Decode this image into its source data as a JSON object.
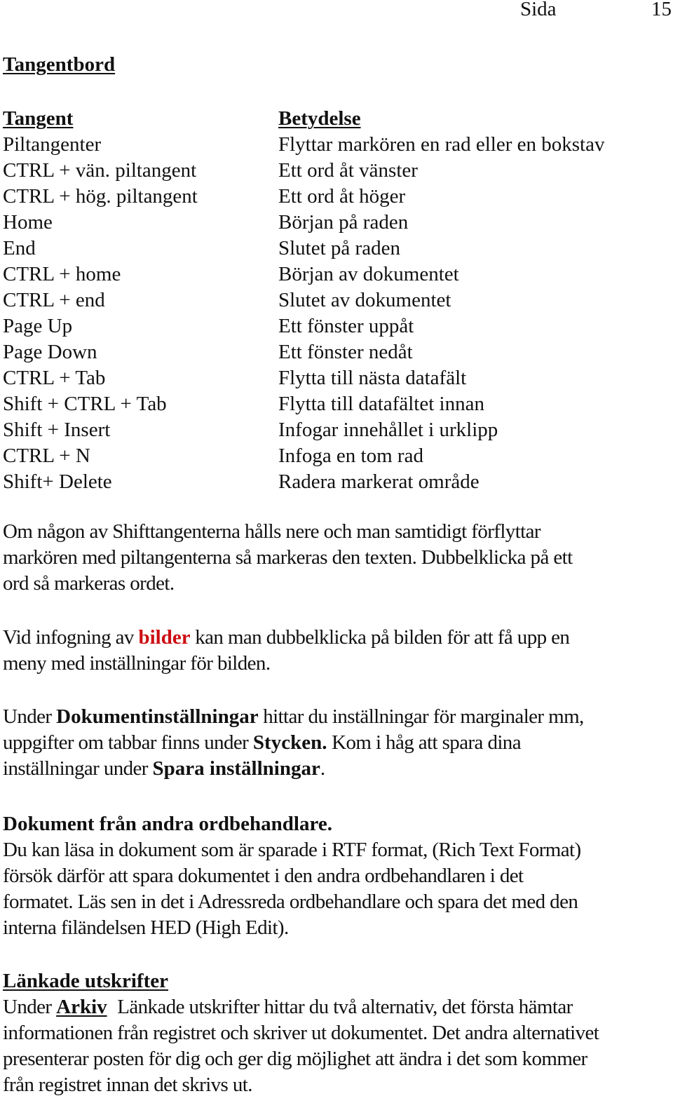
{
  "header": {
    "page_label": "Sida",
    "page_number": "15"
  },
  "title": "Tangentbord",
  "shortcuts": {
    "key_header": "Tangent",
    "desc_header": "Betydelse",
    "rows": [
      {
        "key": "Piltangenter",
        "desc": "Flyttar markören en rad eller en bokstav"
      },
      {
        "key": "CTRL + vän. piltangent",
        "desc": "Ett ord åt vänster"
      },
      {
        "key": "CTRL + hög. piltangent",
        "desc": "Ett ord åt höger"
      },
      {
        "key": "Home",
        "desc": "Början på raden"
      },
      {
        "key": "End",
        "desc": "Slutet på raden"
      },
      {
        "key": "CTRL + home",
        "desc": "Början av dokumentet"
      },
      {
        "key": "CTRL + end",
        "desc": "Slutet av dokumentet"
      },
      {
        "key": "Page Up",
        "desc": "Ett fönster uppåt"
      },
      {
        "key": "Page Down",
        "desc": "Ett fönster nedåt"
      },
      {
        "key": "CTRL + Tab",
        "desc": "Flytta till nästa datafält"
      },
      {
        "key": "Shift + CTRL + Tab",
        "desc": "Flytta till datafältet innan"
      },
      {
        "key": "Shift + Insert",
        "desc": "Infogar innehållet i urklipp"
      },
      {
        "key": "CTRL + N",
        "desc": "Infoga en tom rad"
      },
      {
        "key": "Shift+ Delete",
        "desc": "Radera markerat område"
      }
    ]
  },
  "paragraphs": {
    "shift_select": {
      "lines": [
        "Om någon av Shifttangenterna hålls nere och man samtidigt förflyttar",
        "markören med piltangenterna så markeras den texten. Dubbelklicka på ett",
        "ord så markeras ordet."
      ]
    },
    "images": {
      "pre": "Vid infogning av ",
      "highlight": "bilder",
      "post": " kan man dubbelklicka på bilden för att få upp en",
      "line2": "meny med inställningar för bilden.",
      "highlight_color": "#cc0d12"
    },
    "settings": {
      "l1_pre": "Under ",
      "l1_bold": "Dokumentinställningar",
      "l1_post": " hittar du inställningar för marginaler mm,",
      "l2_pre": "uppgifter om tabbar finns under ",
      "l2_bold": "Stycken.",
      "l2_post": " Kom i håg att spara dina",
      "l3_pre": "inställningar under ",
      "l3_bold": "Spara inställningar",
      "l3_post": "."
    },
    "other_wp": {
      "heading": "Dokument från andra ordbehandlare.",
      "lines": [
        "Du kan läsa in dokument som är sparade i RTF format, (Rich Text Format)",
        "försök därför att spara dokumentet i den andra ordbehandlaren i det",
        "formatet. Läs sen in det i Adressreda ordbehandlare och spara det med den",
        "interna filändelsen HED (High Edit)."
      ]
    },
    "linked_prints": {
      "heading": "Länkade utskrifter",
      "l1_pre": "Under ",
      "l1_bold": "Arkiv",
      "l1_post": " Länkade utskrifter hittar du två alternativ, det första hämtar",
      "lines": [
        "informationen från registret och skriver ut dokumentet. Det andra alternativet",
        "presenterar posten för dig och ger dig möjlighet att ändra i det som kommer",
        "från registret innan det skrivs ut."
      ]
    }
  }
}
